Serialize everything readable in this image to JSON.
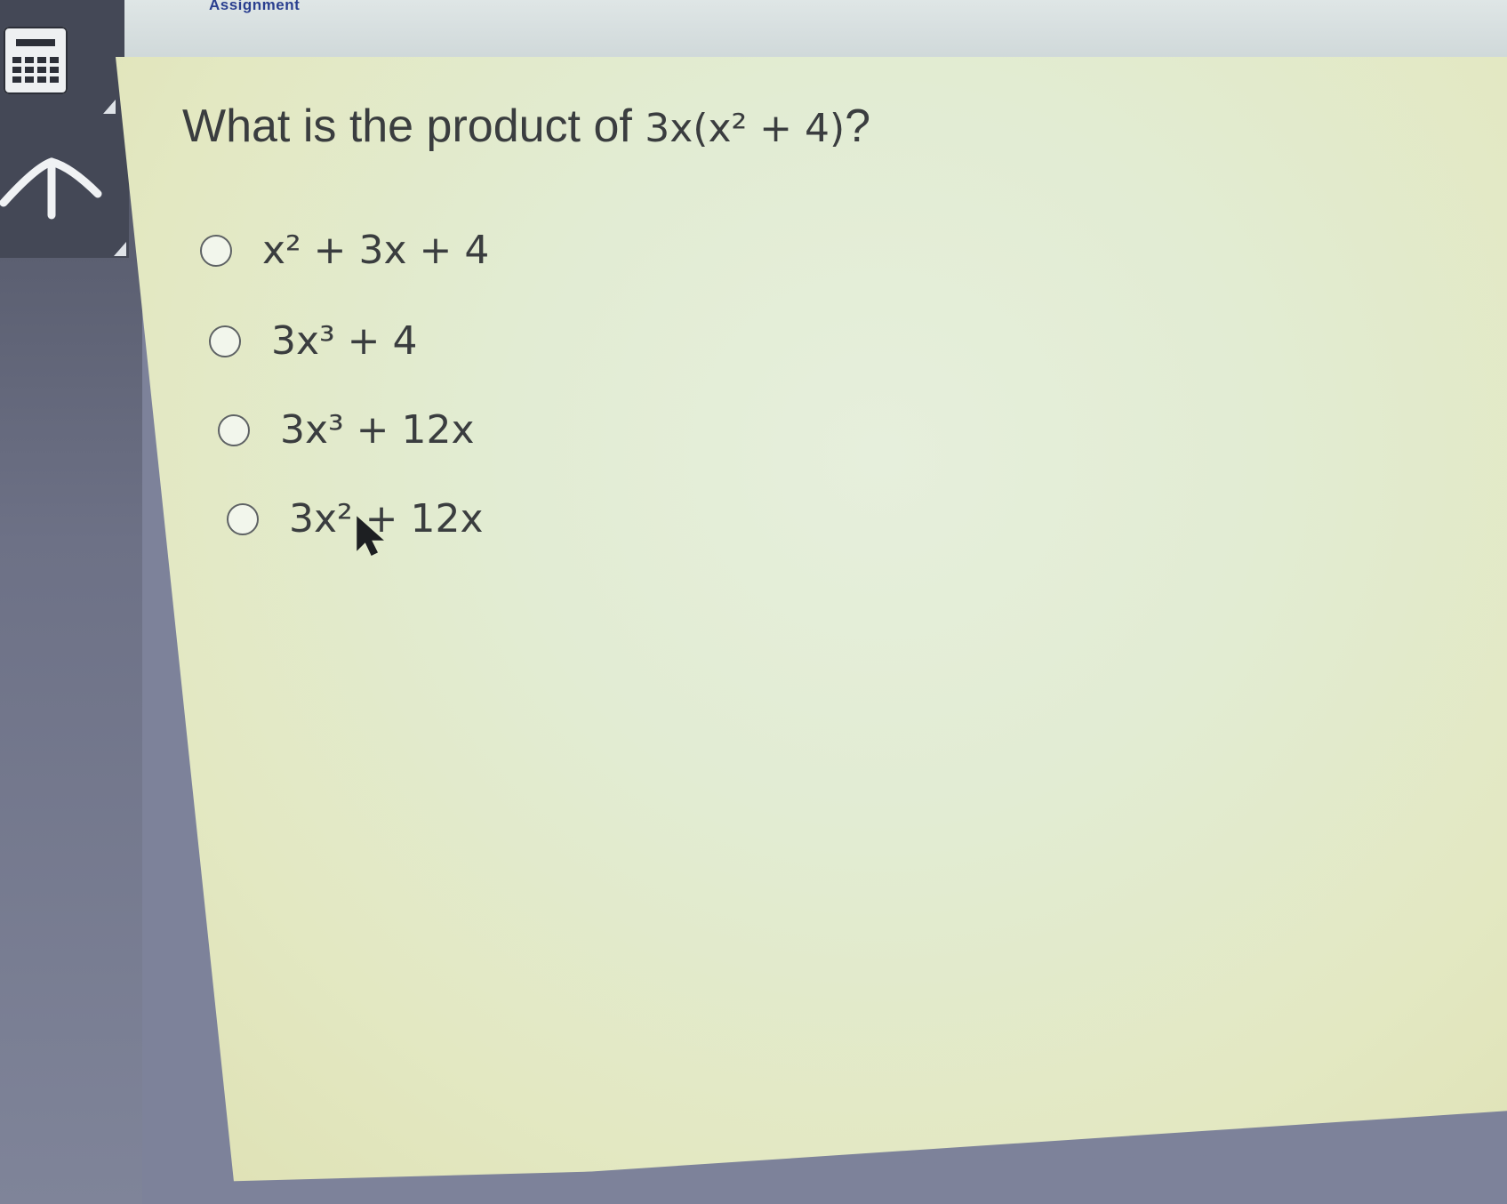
{
  "header": {
    "breadcrumb": "Assignment"
  },
  "toolbar": {
    "calculator_icon": "calculator-icon",
    "up_icon": "up-arrow-icon"
  },
  "question": {
    "prefix": "What is the product of ",
    "expression": "3x(x² + 4)",
    "suffix": "?"
  },
  "options": [
    {
      "label": "x² + 3x + 4",
      "selected": false
    },
    {
      "label": "3x³ + 4",
      "selected": false
    },
    {
      "label": "3x³ + 12x",
      "selected": false
    },
    {
      "label": "3x² + 12x",
      "selected": false
    }
  ],
  "colors": {
    "content_background": "#e2ecd3",
    "text": "#3a3d3f",
    "sidebar": "#6d7186",
    "breadcrumb": "#2a3f8f"
  }
}
